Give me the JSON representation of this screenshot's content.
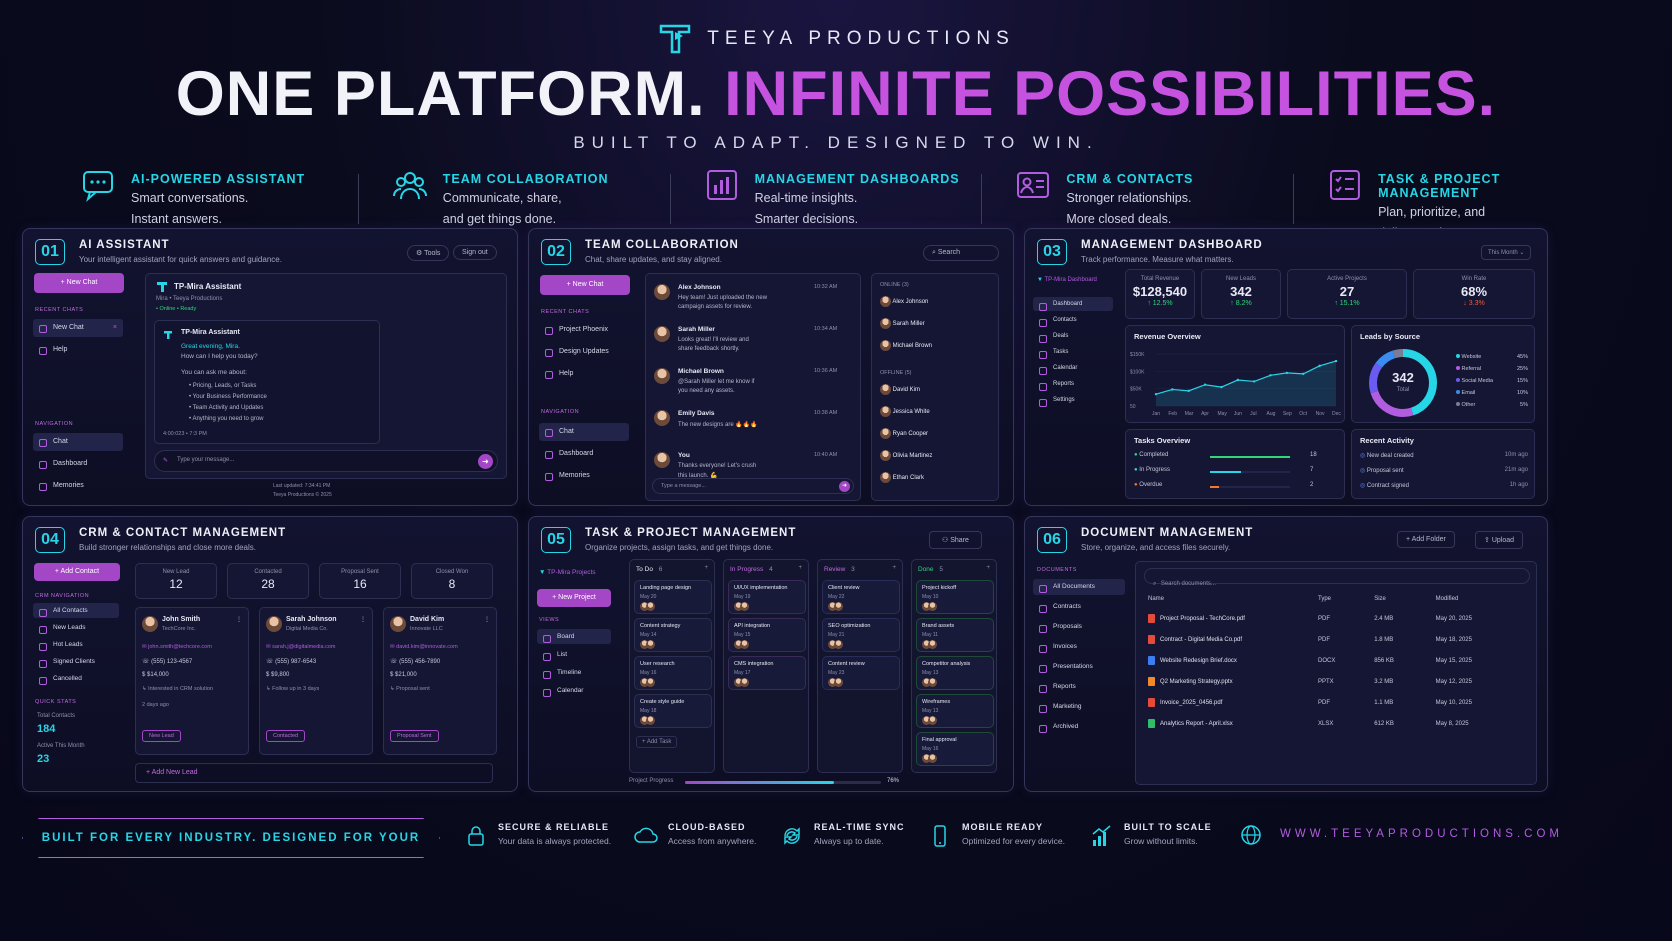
{
  "brand": "TEEYA PRODUCTIONS",
  "headline_a": "ONE PLATFORM.",
  "headline_b": "INFINITE POSSIBILITIES.",
  "tagline": "BUILT TO ADAPT. DESIGNED TO WIN.",
  "features": [
    {
      "title": "AI-POWERED ASSISTANT",
      "l1": "Smart conversations.",
      "l2": "Instant answers.",
      "icon": "chat-bubble-icon"
    },
    {
      "title": "TEAM COLLABORATION",
      "l1": "Communicate, share,",
      "l2": "and get things done.",
      "icon": "team-icon"
    },
    {
      "title": "MANAGEMENT DASHBOARDS",
      "l1": "Real-time insights.",
      "l2": "Smarter decisions.",
      "icon": "bar-chart-icon"
    },
    {
      "title": "CRM & CONTACTS",
      "l1": "Stronger relationships.",
      "l2": "More closed deals.",
      "icon": "contact-card-icon"
    },
    {
      "title": "TASK & PROJECT MANAGEMENT",
      "l1": "Plan, prioritize, and",
      "l2": "deliver on time.",
      "icon": "checklist-icon"
    }
  ],
  "p1": {
    "num": "01",
    "title": "AI ASSISTANT",
    "sub": "Your intelligent assistant for quick answers and guidance.",
    "tools": "Tools",
    "signout": "Sign out",
    "newchat": "+ New Chat",
    "recent": "RECENT CHATS",
    "chats": [
      "New Chat",
      "Help"
    ],
    "navh": "NAVIGATION",
    "nav": [
      "Chat",
      "Dashboard",
      "Memories"
    ],
    "bot": "TP-Mira Assistant",
    "botsub": "Mira • Teeya Productions",
    "online": "• Online • Ready",
    "msgname": "TP-Mira Assistant",
    "greet": "Great evening, Mira.",
    "help": "How can I help you today?",
    "ask": "You can ask me about:",
    "list": [
      "Pricing, Leads, or Tasks",
      "Your Business Performance",
      "Team Activity and Updates",
      "Anything you need to grow"
    ],
    "time": "4:00:023 • 7:3 PM",
    "placeholder": "Type your message...",
    "updated": "Last updated: 7:34:41 PM",
    "copy": "Teeya Productions © 2025"
  },
  "p2": {
    "num": "02",
    "title": "TEAM COLLABORATION",
    "sub": "Chat, share updates, and stay aligned.",
    "search": "Search",
    "newchat": "+ New Chat",
    "recent": "RECENT CHATS",
    "chats": [
      "Project Phoenix",
      "Design Updates",
      "Help"
    ],
    "navh": "NAVIGATION",
    "nav": [
      "Chat",
      "Dashboard",
      "Memories"
    ],
    "msgs": [
      {
        "name": "Alex Johnson",
        "time": "10:32 AM",
        "text": [
          "Hey team! Just uploaded the new",
          "campaign assets for review."
        ]
      },
      {
        "name": "Sarah Miller",
        "time": "10:34 AM",
        "text": [
          "Looks great! I'll review and",
          "share feedback shortly."
        ]
      },
      {
        "name": "Michael Brown",
        "time": "10:36 AM",
        "text": [
          "@Sarah Miller let me know if",
          "you need any assets."
        ]
      },
      {
        "name": "Emily Davis",
        "time": "10:38 AM",
        "text": [
          "The new designs are 🔥🔥🔥",
          ""
        ]
      },
      {
        "name": "You",
        "time": "10:40 AM",
        "text": [
          "Thanks everyone! Let's crush",
          "this launch. 💪"
        ]
      }
    ],
    "placeholder": "Type a message...",
    "online_h": "ONLINE (3)",
    "online": [
      "Alex Johnson",
      "Sarah Miller",
      "Michael Brown"
    ],
    "offline_h": "OFFLINE (5)",
    "offline": [
      "David Kim",
      "Jessica White",
      "Ryan Cooper",
      "Olivia Martinez",
      "Ethan Clark"
    ]
  },
  "p3": {
    "num": "03",
    "title": "MANAGEMENT DASHBOARD",
    "sub": "Track performance. Measure what matters.",
    "period": "This Month",
    "logo": "TP-Mira Dashboard",
    "nav": [
      "Dashboard",
      "Contacts",
      "Deals",
      "Tasks",
      "Calendar",
      "Reports",
      "Settings"
    ],
    "kpis": [
      {
        "l": "Total Revenue",
        "v": "$128,540",
        "c": "↑ 12.5%",
        "up": true
      },
      {
        "l": "New Leads",
        "v": "342",
        "c": "↑ 8.2%",
        "up": true
      },
      {
        "l": "Active Projects",
        "v": "27",
        "c": "↑ 15.1%",
        "up": true
      },
      {
        "l": "Win Rate",
        "v": "68%",
        "c": "↓ 3.3%",
        "up": false
      }
    ],
    "rev_title": "Revenue Overview",
    "leads_title": "Leads by Source",
    "donut_v": "342",
    "donut_l": "Total",
    "sources": [
      {
        "n": "Website",
        "p": "45%",
        "v": 45,
        "c": "#27d6e6"
      },
      {
        "n": "Referral",
        "p": "25%",
        "v": 25,
        "c": "#b25ce0"
      },
      {
        "n": "Social Media",
        "p": "15%",
        "v": 15,
        "c": "#6a5cf0"
      },
      {
        "n": "Email",
        "p": "10%",
        "v": 10,
        "c": "#3a8cf0"
      },
      {
        "n": "Other",
        "p": "5%",
        "v": 5,
        "c": "#7a7d96"
      }
    ],
    "tasks_title": "Tasks Overview",
    "tasks": [
      {
        "n": "Completed",
        "v": "18",
        "c": "#2fd67a",
        "f": 1
      },
      {
        "n": "In Progress",
        "v": "7",
        "c": "#27d6e6",
        "f": 0.39
      },
      {
        "n": "Overdue",
        "v": "2",
        "c": "#f07a2a",
        "f": 0.11
      }
    ],
    "act_title": "Recent Activity",
    "acts": [
      {
        "n": "New deal created",
        "t": "10m ago"
      },
      {
        "n": "Proposal sent",
        "t": "21m ago"
      },
      {
        "n": "Contract signed",
        "t": "1h ago"
      }
    ]
  },
  "chart_data": {
    "type": "area",
    "x": [
      "Jan",
      "Feb",
      "Mar",
      "Apr",
      "May",
      "Jun",
      "Jul",
      "Aug",
      "Sep",
      "Oct",
      "Nov",
      "Dec"
    ],
    "yticks": [
      "$150K",
      "$100K",
      "$50K",
      "50"
    ],
    "series": [
      {
        "values": [
          25,
          35,
          32,
          45,
          40,
          55,
          52,
          65,
          70,
          68,
          85,
          95
        ]
      }
    ]
  },
  "p4": {
    "num": "04",
    "title": "CRM & CONTACT MANAGEMENT",
    "sub": "Build stronger relationships and close more deals.",
    "add": "+ Add Contact",
    "navh": "CRM NAVIGATION",
    "nav": [
      "All Contacts",
      "New Leads",
      "Hot Leads",
      "Signed Clients",
      "Cancelled"
    ],
    "qsh": "QUICK STATS",
    "q1l": "Total Contacts",
    "q1v": "184",
    "q2l": "Active This Month",
    "q2v": "23",
    "stats": [
      {
        "l": "New Lead",
        "v": "12"
      },
      {
        "l": "Contacted",
        "v": "28"
      },
      {
        "l": "Proposal Sent",
        "v": "16"
      },
      {
        "l": "Closed Won",
        "v": "8"
      }
    ],
    "contacts": [
      {
        "n": "John Smith",
        "co": "TechCore Inc.",
        "e": "john.smith@techcore.com",
        "p": "(555) 123-4567",
        "v": "$14,000",
        "note": "Interested in CRM solution",
        "age": "2 days ago",
        "tag": "New Lead"
      },
      {
        "n": "Sarah Johnson",
        "co": "Digital Media Co.",
        "e": "sarah.j@digitalmedia.com",
        "p": "(555) 987-6543",
        "v": "$9,800",
        "note": "Follow up in 3 days",
        "age": "",
        "tag": "Contacted"
      },
      {
        "n": "David Kim",
        "co": "Innovate LLC",
        "e": "david.kim@innovate.com",
        "p": "(555) 456-7890",
        "v": "$21,000",
        "note": "Proposal sent",
        "age": "",
        "tag": "Proposal Sent"
      }
    ],
    "addlead": "+ Add New Lead"
  },
  "p5": {
    "num": "05",
    "title": "TASK & PROJECT MANAGEMENT",
    "sub": "Organize projects, assign tasks, and get things done.",
    "share": "Share",
    "logo": "TP-Mira Projects",
    "newp": "+ New Project",
    "viewsh": "VIEWS",
    "views": [
      "Board",
      "List",
      "Timeline",
      "Calendar"
    ],
    "cols": [
      {
        "n": "To Do",
        "c": "6",
        "cards": [
          [
            "Landing page design",
            "May 20"
          ],
          [
            "Content strategy",
            "May 14"
          ],
          [
            "User research",
            "May 16"
          ],
          [
            "Create style guide",
            "May 18"
          ]
        ],
        "add": "+ Add Task"
      },
      {
        "n": "In Progress",
        "c": "4",
        "cards": [
          [
            "UI/UX implementation",
            "May 19"
          ],
          [
            "API integration",
            "May 15"
          ],
          [
            "CMS integration",
            "May 17"
          ]
        ]
      },
      {
        "n": "Review",
        "c": "3",
        "cards": [
          [
            "Client review",
            "May 22"
          ],
          [
            "SEO optimization",
            "May 21"
          ],
          [
            "Content review",
            "May 23"
          ]
        ]
      },
      {
        "n": "Done",
        "c": "5",
        "cards": [
          [
            "Project kickoff",
            "May 10"
          ],
          [
            "Brand assets",
            "May 11"
          ],
          [
            "Competitor analysis",
            "May 13"
          ],
          [
            "Wireframes",
            "May 13"
          ],
          [
            "Final approval",
            "May 16"
          ]
        ]
      }
    ],
    "prog_l": "Project Progress",
    "prog_v": "76%",
    "prog": 0.76
  },
  "p6": {
    "num": "06",
    "title": "DOCUMENT MANAGEMENT",
    "sub": "Store, organize, and access files securely.",
    "addf": "+ Add Folder",
    "upload": "Upload",
    "docsh": "DOCUMENTS",
    "nav": [
      "All Documents",
      "Contracts",
      "Proposals",
      "Invoices",
      "Presentations",
      "Reports",
      "Marketing",
      "Archived"
    ],
    "search": "Search documents...",
    "cols": [
      "Name",
      "Type",
      "Size",
      "Modified"
    ],
    "rows": [
      [
        "Project Proposal - TechCore.pdf",
        "PDF",
        "2.4 MB",
        "May 20, 2025",
        "#e64a3a"
      ],
      [
        "Contract - Digital Media Co.pdf",
        "PDF",
        "1.8 MB",
        "May 18, 2025",
        "#e64a3a"
      ],
      [
        "Website Redesign Brief.docx",
        "DOCX",
        "856 KB",
        "May 15, 2025",
        "#3a7ef0"
      ],
      [
        "Q2 Marketing Strategy.pptx",
        "PPTX",
        "3.2 MB",
        "May 12, 2025",
        "#f08a2a"
      ],
      [
        "Invoice_2025_0456.pdf",
        "PDF",
        "1.1 MB",
        "May 10, 2025",
        "#e64a3a"
      ],
      [
        "Analytics Report - April.xlsx",
        "XLSX",
        "612 KB",
        "May 8, 2025",
        "#2fbf6a"
      ]
    ]
  },
  "footer": {
    "banner": "BUILT FOR EVERY INDUSTRY. DESIGNED FOR YOUR SUCCESS.",
    "items": [
      {
        "t": "SECURE & RELIABLE",
        "d": "Your data is always protected."
      },
      {
        "t": "CLOUD-BASED",
        "d": "Access from anywhere."
      },
      {
        "t": "REAL-TIME SYNC",
        "d": "Always up to date."
      },
      {
        "t": "MOBILE READY",
        "d": "Optimized for every device."
      },
      {
        "t": "BUILT TO SCALE",
        "d": "Grow without limits."
      }
    ],
    "url": "WWW.TEEYAPRODUCTIONS.COM"
  }
}
